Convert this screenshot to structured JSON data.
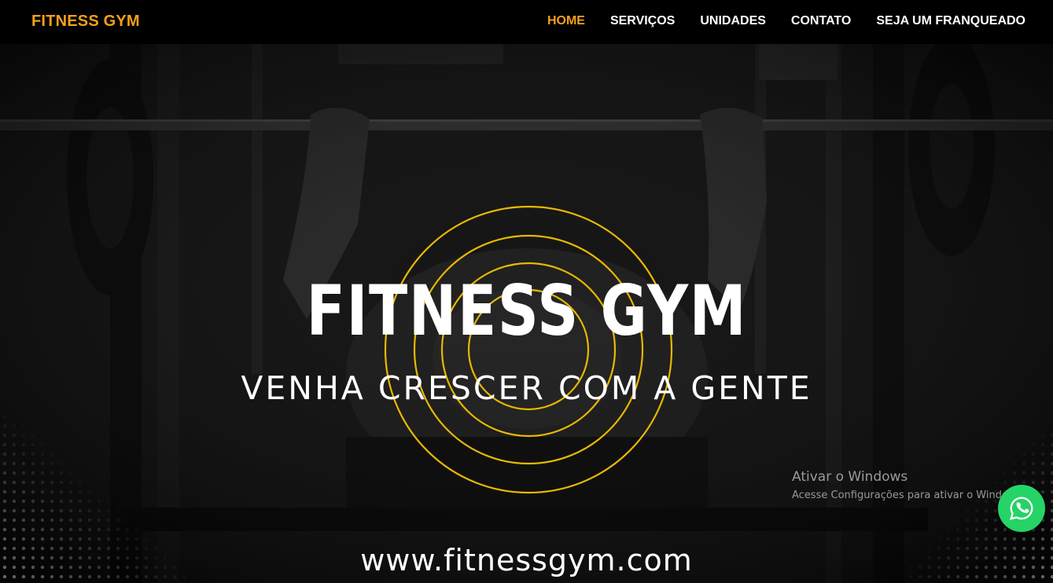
{
  "header": {
    "brand": "FITNESS GYM",
    "nav": [
      {
        "label": "HOME",
        "active": true
      },
      {
        "label": "SERVIÇOS",
        "active": false
      },
      {
        "label": "UNIDADES",
        "active": false
      },
      {
        "label": "CONTATO",
        "active": false
      },
      {
        "label": "SEJA UM FRANQUEADO",
        "active": false
      }
    ]
  },
  "hero": {
    "title": "FITNESS GYM",
    "subtitle": "VENHA CRESCER COM A GENTE",
    "website": "www.fitnessgym.com"
  },
  "windows_watermark": {
    "title": "Ativar o Windows",
    "subtitle": "Acesse Configurações para ativar o Windows."
  },
  "whatsapp": {
    "icon": "whatsapp-icon"
  },
  "colors": {
    "accent": "#f5a01a",
    "ring": "#e8b800",
    "whatsapp": "#25d366",
    "background": "#000000"
  }
}
